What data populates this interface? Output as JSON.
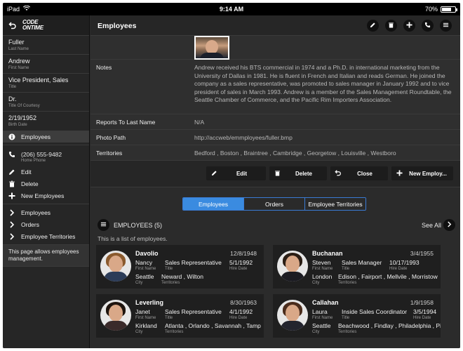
{
  "statusbar": {
    "device": "iPad",
    "time": "9:14 AM",
    "battery": "70%",
    "battery_level": 0.7
  },
  "brand": {
    "line1": "CODE",
    "line2": "ONTIME"
  },
  "sidebar": {
    "fields": [
      {
        "value": "Fuller",
        "label": "Last Name"
      },
      {
        "value": "Andrew",
        "label": "First Name"
      },
      {
        "value": "Vice President, Sales",
        "label": "Title"
      },
      {
        "value": "Dr.",
        "label": "Title Of Courtesy"
      },
      {
        "value": "2/19/1952",
        "label": "Birth Date"
      }
    ],
    "active_item": "Employees",
    "phone": {
      "value": "(206) 555-9482",
      "label": "Home Phone"
    },
    "actions": [
      "Edit",
      "Delete",
      "New Employees"
    ],
    "links": [
      "Employees",
      "Orders",
      "Employee Territories"
    ],
    "note": "This page allows employees management."
  },
  "header": {
    "title": "Employees"
  },
  "detail": {
    "notes_label": "Notes",
    "notes": "Andrew received his BTS commercial in 1974 and a Ph.D. in international marketing from the University of Dallas in 1981. He is fluent in French and Italian and reads German. He joined the company as a sales representative, was promoted to sales manager in January 1992 and to vice president of sales in March 1993. Andrew is a member of the Sales Management Roundtable, the Seattle Chamber of Commerce, and the Pacific Rim Importers Association.",
    "reports_label": "Reports To Last Name",
    "reports": "N/A",
    "photo_label": "Photo Path",
    "photo": "http://accweb/emmployees/fuller.bmp",
    "territories_label": "Territories",
    "territories": "Bedford , Boston , Braintree , Cambridge , Georgetow , Louisville , Westboro"
  },
  "actions": {
    "edit": "Edit",
    "delete": "Delete",
    "close": "Close",
    "new": "New Employ..."
  },
  "tabs": [
    "Employees",
    "Orders",
    "Employee Territories"
  ],
  "employees": {
    "title": "EMPLOYEES (5)",
    "see_all": "See All",
    "description": "This is a list of employees.",
    "labels": {
      "first": "First Name",
      "title": "Title",
      "hire": "Hire Date",
      "city": "City",
      "territories": "Territories"
    },
    "cards": [
      {
        "last": "Davolio",
        "birth": "12/8/1948",
        "first": "Nancy",
        "title": "Sales Representative",
        "hire": "5/1/1992",
        "city": "Seattle",
        "territories": "Neward , Wilton"
      },
      {
        "last": "Buchanan",
        "birth": "3/4/1955",
        "first": "Steven",
        "title": "Sales Manager",
        "hire": "10/17/1993",
        "city": "London",
        "territories": "Edison , Fairport , Mellvile , Morristow"
      },
      {
        "last": "Leverling",
        "birth": "8/30/1963",
        "first": "Janet",
        "title": "Sales Representative",
        "hire": "4/1/1992",
        "city": "Kirkland",
        "territories": "Atlanta , Orlando , Savannah , Tamp"
      },
      {
        "last": "Callahan",
        "birth": "1/9/1958",
        "first": "Laura",
        "title": "Inside Sales Coordinator",
        "hire": "3/5/1994",
        "city": "Seattle",
        "territories": "Beachwood , Findlay , Philadelphia , Pi"
      }
    ]
  }
}
